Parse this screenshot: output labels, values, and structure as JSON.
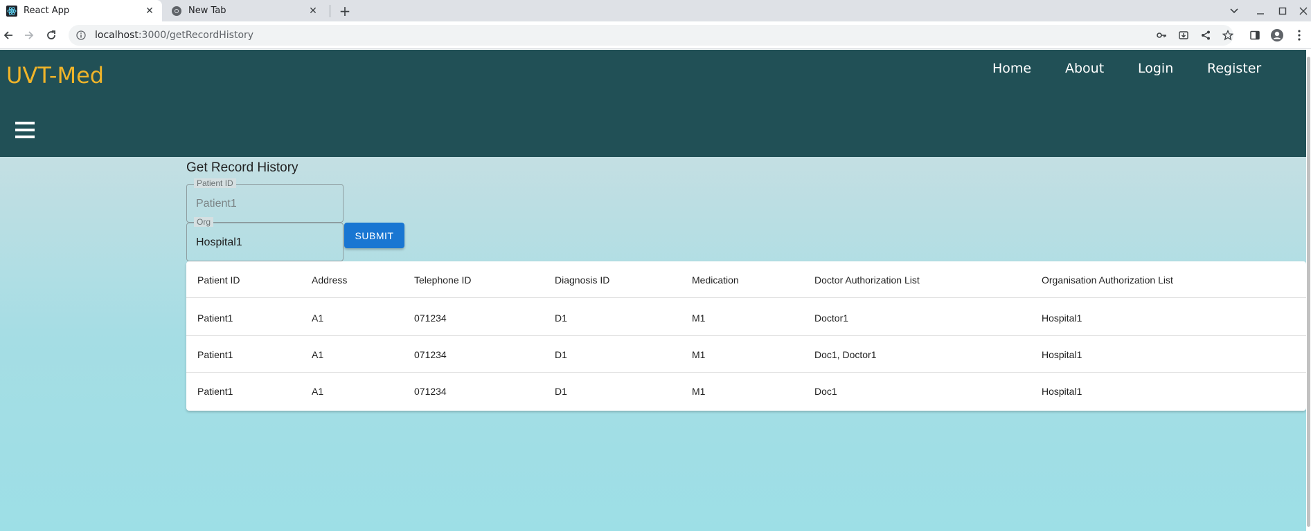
{
  "browser": {
    "tabs": [
      {
        "title": "React App",
        "active": true,
        "icon": "react-icon"
      },
      {
        "title": "New Tab",
        "active": false,
        "icon": "chrome-icon"
      }
    ],
    "url_host": "localhost",
    "url_path": ":3000/getRecordHistory"
  },
  "app": {
    "brand": "UVT-Med",
    "nav": [
      "Home",
      "About",
      "Login",
      "Register"
    ],
    "colors": {
      "appbar": "#215056",
      "brand": "#f0b429",
      "button": "#1976d2"
    }
  },
  "form": {
    "title": "Get Record History",
    "patient_label": "Patient ID",
    "patient_placeholder": "Patient1",
    "org_label": "Org",
    "org_value": "Hospital1",
    "submit_label": "SUBMIT"
  },
  "table": {
    "columns": [
      "Patient ID",
      "Address",
      "Telephone ID",
      "Diagnosis ID",
      "Medication",
      "Doctor Authorization List",
      "Organisation Authorization List"
    ],
    "rows": [
      [
        "Patient1",
        "A1",
        "071234",
        "D1",
        "M1",
        "Doctor1",
        "Hospital1"
      ],
      [
        "Patient1",
        "A1",
        "071234",
        "D1",
        "M1",
        "Doc1, Doctor1",
        "Hospital1"
      ],
      [
        "Patient1",
        "A1",
        "071234",
        "D1",
        "M1",
        "Doc1",
        "Hospital1"
      ]
    ]
  }
}
